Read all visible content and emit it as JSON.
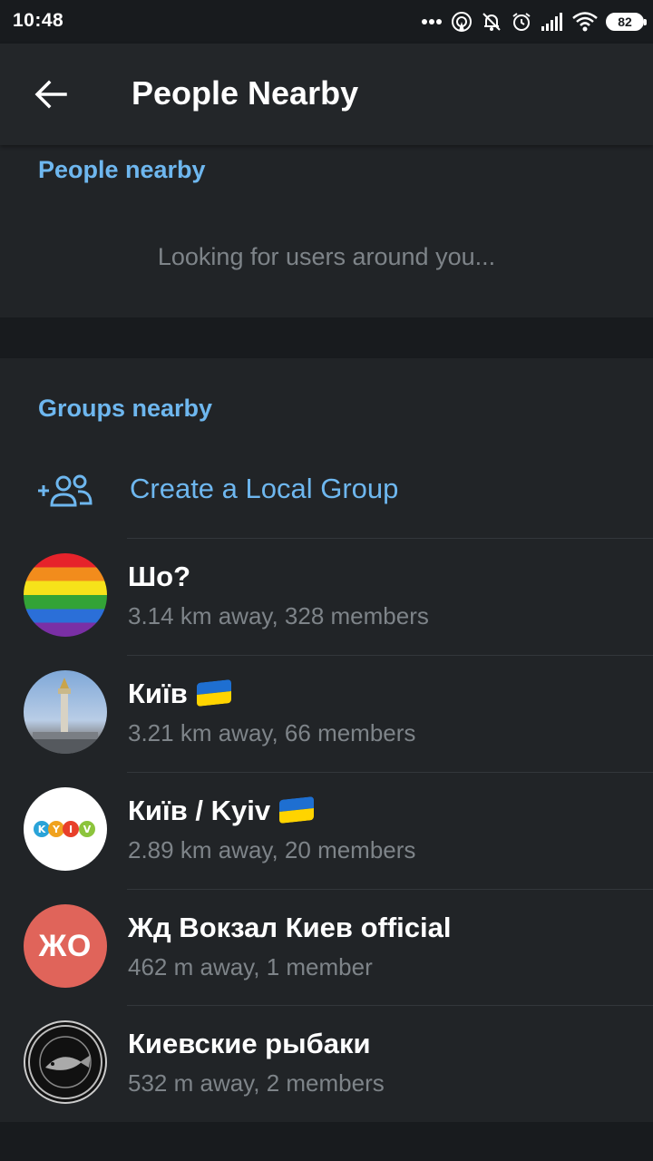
{
  "status": {
    "time": "10:48",
    "battery": "82"
  },
  "appbar": {
    "title": "People Nearby"
  },
  "people_section": {
    "header": "People nearby",
    "status_text": "Looking for users around you..."
  },
  "groups_section": {
    "header": "Groups nearby",
    "create_label": "Create a Local Group",
    "groups": [
      {
        "name": "Шо?",
        "subtitle": "3.14 km away, 328 members"
      },
      {
        "name": "Київ",
        "subtitle": "3.21 km away, 66 members"
      },
      {
        "name": "Київ / Kyiv",
        "subtitle": "2.89 km away, 20 members"
      },
      {
        "name": "Жд Вокзал Киев official",
        "subtitle": "462 m away, 1 member",
        "avatar_initials": "ЖО"
      },
      {
        "name": "Киевские рыбаки",
        "subtitle": "532 m away, 2 members"
      }
    ]
  },
  "colors": {
    "accent": "#6eb7ef",
    "background": "#212427",
    "appbar": "#232629",
    "avatar_zho": "#e0645a"
  }
}
